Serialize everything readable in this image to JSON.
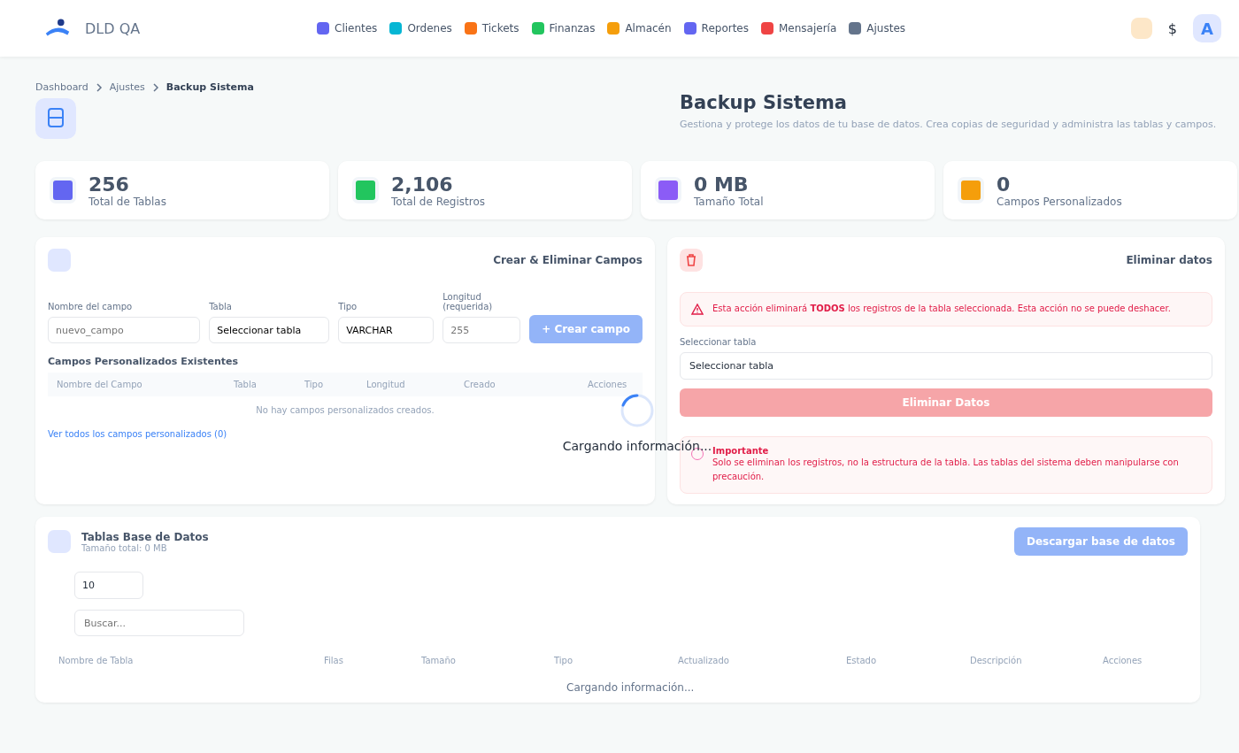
{
  "brand": "DLD QA",
  "nav": [
    {
      "label": "Clientes",
      "color": "#6366f1"
    },
    {
      "label": "Ordenes",
      "color": "#06b6d4"
    },
    {
      "label": "Tickets",
      "color": "#f97316"
    },
    {
      "label": "Finanzas",
      "color": "#22c55e"
    },
    {
      "label": "Almacén",
      "color": "#f59e0b"
    },
    {
      "label": "Reportes",
      "color": "#6366f1"
    },
    {
      "label": "Mensajería",
      "color": "#ef4444"
    },
    {
      "label": "Ajustes",
      "color": "#64748b"
    }
  ],
  "header_right": {
    "currency": "$",
    "avatar": "A"
  },
  "breadcrumb": [
    "Dashboard",
    "Ajustes",
    "Backup Sistema"
  ],
  "page": {
    "title": "Backup Sistema",
    "subtitle": "Gestiona y protege los datos de tu base de datos. Crea copias de seguridad y administra las tablas y campos."
  },
  "stats": [
    {
      "value": "256",
      "label": "Total de Tablas",
      "color": "#6366f1"
    },
    {
      "value": "2,106",
      "label": "Total de Registros",
      "color": "#22c55e"
    },
    {
      "value": "0 MB",
      "label": "Tamaño Total",
      "color": "#8b5cf6"
    },
    {
      "value": "0",
      "label": "Campos Personalizados",
      "color": "#f59e0b"
    }
  ],
  "fields_card": {
    "title": "Crear & Eliminar Campos",
    "form": [
      {
        "label": "Nombre del campo",
        "placeholder": "nuevo_campo"
      },
      {
        "label": "Tabla",
        "value": "Seleccionar tabla"
      },
      {
        "label": "Tipo",
        "value": "VARCHAR"
      },
      {
        "label": "Longitud (requerida)",
        "placeholder": "255"
      }
    ],
    "create_button": "+ Crear campo",
    "existing_title": "Campos Personalizados Existentes",
    "columns": [
      "Nombre del Campo",
      "Tabla",
      "Tipo",
      "Longitud",
      "Creado",
      "Acciones"
    ],
    "empty": "No hay campos personalizados creados.",
    "link": "Ver todos los campos personalizados (0)"
  },
  "delete_card": {
    "title": "Eliminar datos",
    "warning": "Esta acción eliminará **TODOS** los registros de la tabla seleccionada. Esta acción no se puede deshacer.",
    "select_label": "Seleccionar tabla",
    "select_value": "Seleccionar tabla",
    "button": "Eliminar Datos",
    "note_title": "Importante",
    "note": "Solo se eliminan los registros, no la estructura de la tabla. Las tablas del sistema deben manipularse con precaución."
  },
  "tables_card": {
    "title": "Tablas Base de Datos",
    "subtitle": "Tamaño total: 0 MB",
    "download": "Descargar base de datos",
    "page_size": "10",
    "search_placeholder": "Buscar...",
    "columns": [
      "Nombre de Tabla",
      "Filas",
      "Tamaño",
      "Tipo",
      "Actualizado",
      "Estado",
      "Descripción",
      "Acciones"
    ],
    "loading": "Cargando información..."
  },
  "overlay": {
    "loading": "Cargando información..."
  }
}
